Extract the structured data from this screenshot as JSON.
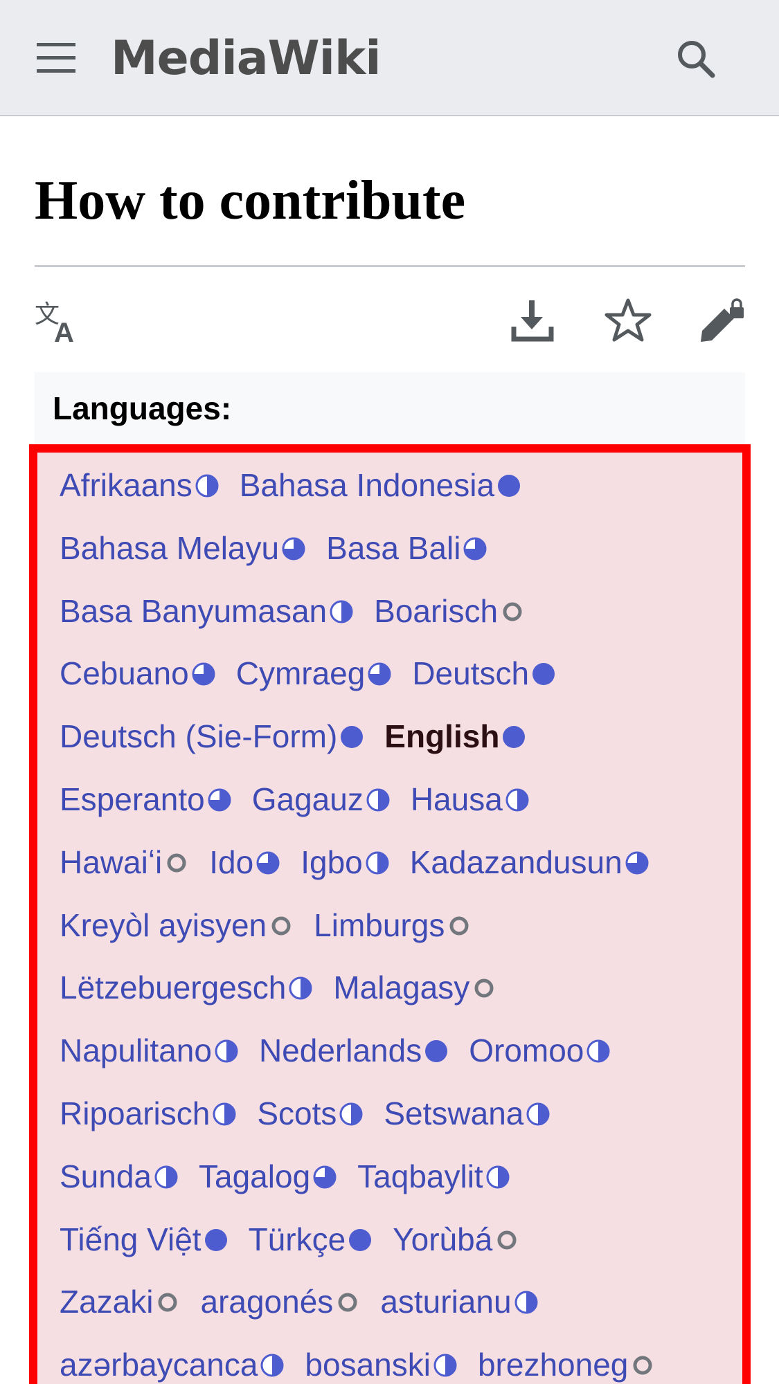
{
  "header": {
    "logo": "MediaWiki",
    "background": "#eaecf0"
  },
  "page": {
    "title": "How to contribute"
  },
  "toolbar": {
    "icons": [
      "translate-icon",
      "download-icon",
      "watch-star-icon",
      "edit-protected-icon"
    ]
  },
  "languages": {
    "heading": "Languages:",
    "link_color": "#3e4bb4",
    "highlight_border": "#ff0000",
    "rows": [
      [
        {
          "name": "Afrikaans",
          "status": "half"
        },
        {
          "name": "Bahasa Indonesia",
          "status": "full"
        }
      ],
      [
        {
          "name": "Bahasa Melayu",
          "status": "three-quarter"
        },
        {
          "name": "Basa Bali",
          "status": "three-quarter"
        }
      ],
      [
        {
          "name": "Basa Banyumasan",
          "status": "half"
        },
        {
          "name": "Boarisch",
          "status": "empty"
        }
      ],
      [
        {
          "name": "Cebuano",
          "status": "three-quarter"
        },
        {
          "name": "Cymraeg",
          "status": "three-quarter"
        },
        {
          "name": "Deutsch",
          "status": "full"
        }
      ],
      [
        {
          "name": "Deutsch (Sie-Form)",
          "status": "full"
        },
        {
          "name": "English",
          "status": "full",
          "current": true
        }
      ],
      [
        {
          "name": "Esperanto",
          "status": "three-quarter"
        },
        {
          "name": "Gagauz",
          "status": "half"
        },
        {
          "name": "Hausa",
          "status": "half"
        }
      ],
      [
        {
          "name": "Hawaiʻi",
          "status": "empty"
        },
        {
          "name": "Ido",
          "status": "three-quarter"
        },
        {
          "name": "Igbo",
          "status": "half"
        },
        {
          "name": "Kadazandusun",
          "status": "three-quarter"
        }
      ],
      [
        {
          "name": "Kreyòl ayisyen",
          "status": "empty"
        },
        {
          "name": "Limburgs",
          "status": "empty"
        }
      ],
      [
        {
          "name": "Lëtzebuergesch",
          "status": "half"
        },
        {
          "name": "Malagasy",
          "status": "empty"
        }
      ],
      [
        {
          "name": "Napulitano",
          "status": "half"
        },
        {
          "name": "Nederlands",
          "status": "full"
        },
        {
          "name": "Oromoo",
          "status": "half"
        }
      ],
      [
        {
          "name": "Ripoarisch",
          "status": "half"
        },
        {
          "name": "Scots",
          "status": "half"
        },
        {
          "name": "Setswana",
          "status": "half"
        }
      ],
      [
        {
          "name": "Sunda",
          "status": "half"
        },
        {
          "name": "Tagalog",
          "status": "three-quarter"
        },
        {
          "name": "Taqbaylit",
          "status": "half"
        }
      ],
      [
        {
          "name": "Tiếng Việt",
          "status": "full"
        },
        {
          "name": "Türkçe",
          "status": "full"
        },
        {
          "name": "Yorùbá",
          "status": "empty"
        }
      ],
      [
        {
          "name": "Zazaki",
          "status": "empty"
        },
        {
          "name": "aragonés",
          "status": "empty"
        },
        {
          "name": "asturianu",
          "status": "half"
        }
      ],
      [
        {
          "name": "azərbaycanca",
          "status": "half"
        },
        {
          "name": "bosanski",
          "status": "half"
        },
        {
          "name": "brezhoneg",
          "status": "empty"
        }
      ]
    ]
  }
}
